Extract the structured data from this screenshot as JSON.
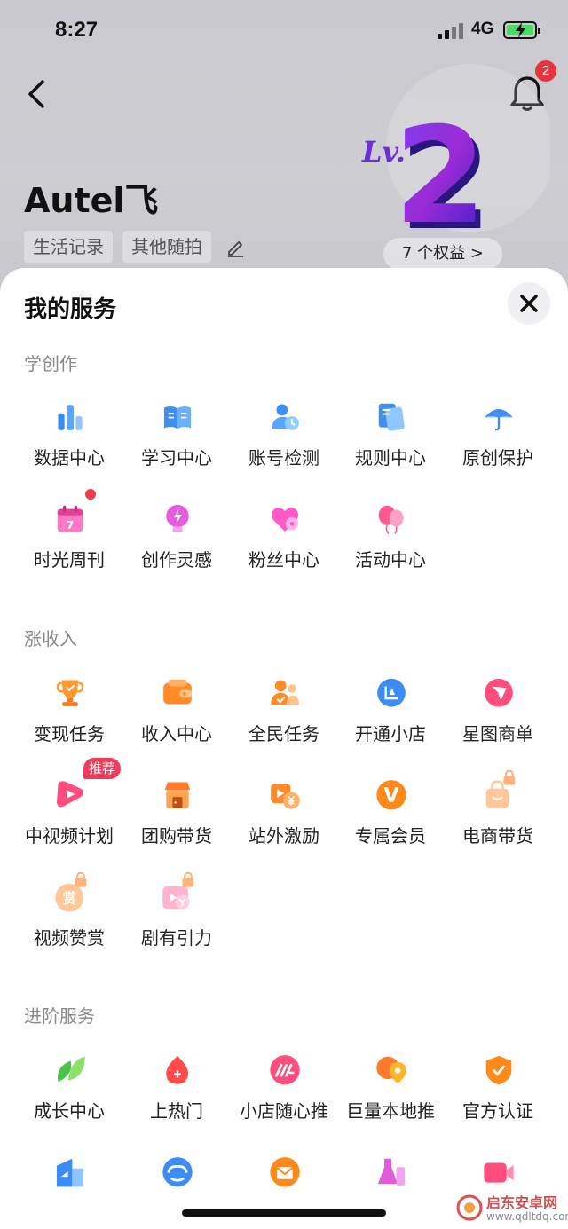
{
  "status_bar": {
    "time": "8:27",
    "network": "4G"
  },
  "header": {
    "username": "Autel飞",
    "tags": [
      "生活记录",
      "其他随拍"
    ],
    "notification_count": "2",
    "level_prefix": "Lv.",
    "level_number": "2",
    "benefits_label": "7 个权益 >"
  },
  "sheet": {
    "title": "我的服务",
    "sections": [
      {
        "title": "学创作",
        "items": [
          {
            "label": "数据中心",
            "icon": "bar-chart-icon"
          },
          {
            "label": "学习中心",
            "icon": "book-icon"
          },
          {
            "label": "账号检测",
            "icon": "account-check-icon"
          },
          {
            "label": "规则中心",
            "icon": "document-icon"
          },
          {
            "label": "原创保护",
            "icon": "umbrella-icon"
          },
          {
            "label": "时光周刊",
            "icon": "calendar-icon",
            "dot": true,
            "calendar_number": "7"
          },
          {
            "label": "创作灵感",
            "icon": "lightbulb-icon"
          },
          {
            "label": "粉丝中心",
            "icon": "heart-icon"
          },
          {
            "label": "活动中心",
            "icon": "balloon-icon"
          }
        ]
      },
      {
        "title": "涨收入",
        "items": [
          {
            "label": "变现任务",
            "icon": "trophy-icon"
          },
          {
            "label": "收入中心",
            "icon": "wallet-icon"
          },
          {
            "label": "全民任务",
            "icon": "people-icon"
          },
          {
            "label": "开通小店",
            "icon": "shop-icon"
          },
          {
            "label": "星图商单",
            "icon": "star-map-icon"
          },
          {
            "label": "中视频计划",
            "icon": "play-icon",
            "badge": "推荐"
          },
          {
            "label": "团购带货",
            "icon": "store-icon"
          },
          {
            "label": "站外激励",
            "icon": "reward-icon"
          },
          {
            "label": "专属会员",
            "icon": "vip-icon",
            "glyph": "V"
          },
          {
            "label": "电商带货",
            "icon": "bag-icon",
            "locked": true
          },
          {
            "label": "视频赞赏",
            "icon": "tip-icon",
            "locked": true,
            "glyph": "赏"
          },
          {
            "label": "剧有引力",
            "icon": "drama-icon",
            "locked": true
          }
        ]
      },
      {
        "title": "进阶服务",
        "items": [
          {
            "label": "成长中心",
            "icon": "leaf-icon"
          },
          {
            "label": "上热门",
            "icon": "flame-icon"
          },
          {
            "label": "小店随心推",
            "icon": "boost-icon"
          },
          {
            "label": "巨量本地推",
            "icon": "location-icon"
          },
          {
            "label": "官方认证",
            "icon": "badge-icon"
          },
          {
            "label": "",
            "icon": "building-icon"
          },
          {
            "label": "",
            "icon": "cloud-icon"
          },
          {
            "label": "",
            "icon": "envelope-icon"
          },
          {
            "label": "",
            "icon": "flask-icon"
          },
          {
            "label": "",
            "icon": "camera-icon"
          }
        ]
      }
    ]
  },
  "watermark": {
    "line1": "启东安卓网",
    "line2": "www.qdltdq.com"
  }
}
